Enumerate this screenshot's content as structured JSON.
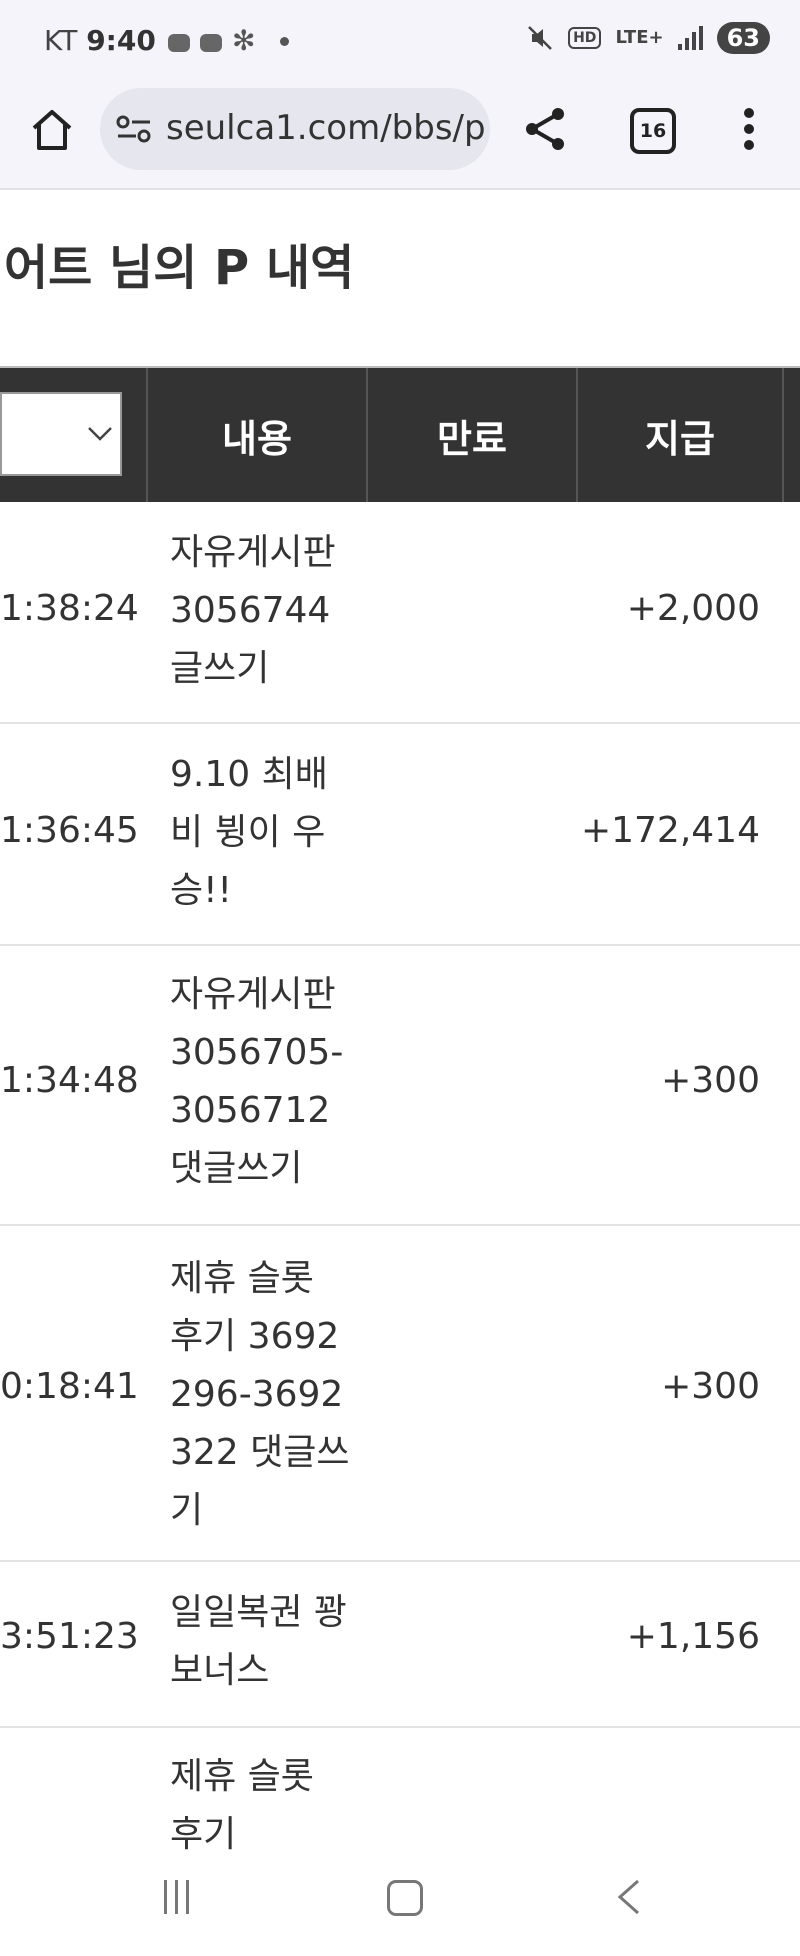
{
  "status_bar": {
    "carrier": "KT",
    "time": "9:40",
    "network": "LTE+",
    "battery": "63"
  },
  "browser": {
    "url": "seulca1.com/bbs/p",
    "tab_count": "16"
  },
  "page": {
    "title": "어트 님의 P 내역"
  },
  "table": {
    "headers": {
      "content": "내용",
      "expiry": "만료",
      "payment": "지급"
    },
    "rows": [
      {
        "time": "1:38:24",
        "content": "자유게시판 3056744 글쓰기",
        "expiry": "",
        "amount": "+2,000"
      },
      {
        "time": "1:36:45",
        "content": "9.10 최배비 뷩이 우승!!",
        "expiry": "",
        "amount": "+172,414"
      },
      {
        "time": "1:34:48",
        "content": "자유게시판 3056705-3056712 댓글쓰기",
        "expiry": "",
        "amount": "+300"
      },
      {
        "time": "0:18:41",
        "content": "제휴 슬롯 후기 3692296-3692322 댓글쓰기",
        "expiry": "",
        "amount": "+300"
      },
      {
        "time": "3:51:23",
        "content": "일일복권 꽝 보너스",
        "expiry": "",
        "amount": "+1,156"
      },
      {
        "time": "",
        "content": "제휴 슬롯 후기",
        "expiry": "",
        "amount": ""
      }
    ]
  },
  "icons": {
    "home": "home-icon",
    "site_info": "site-info-icon",
    "share": "share-icon",
    "menu": "more-vert-icon",
    "select_chevron": "chevron-down-icon"
  }
}
